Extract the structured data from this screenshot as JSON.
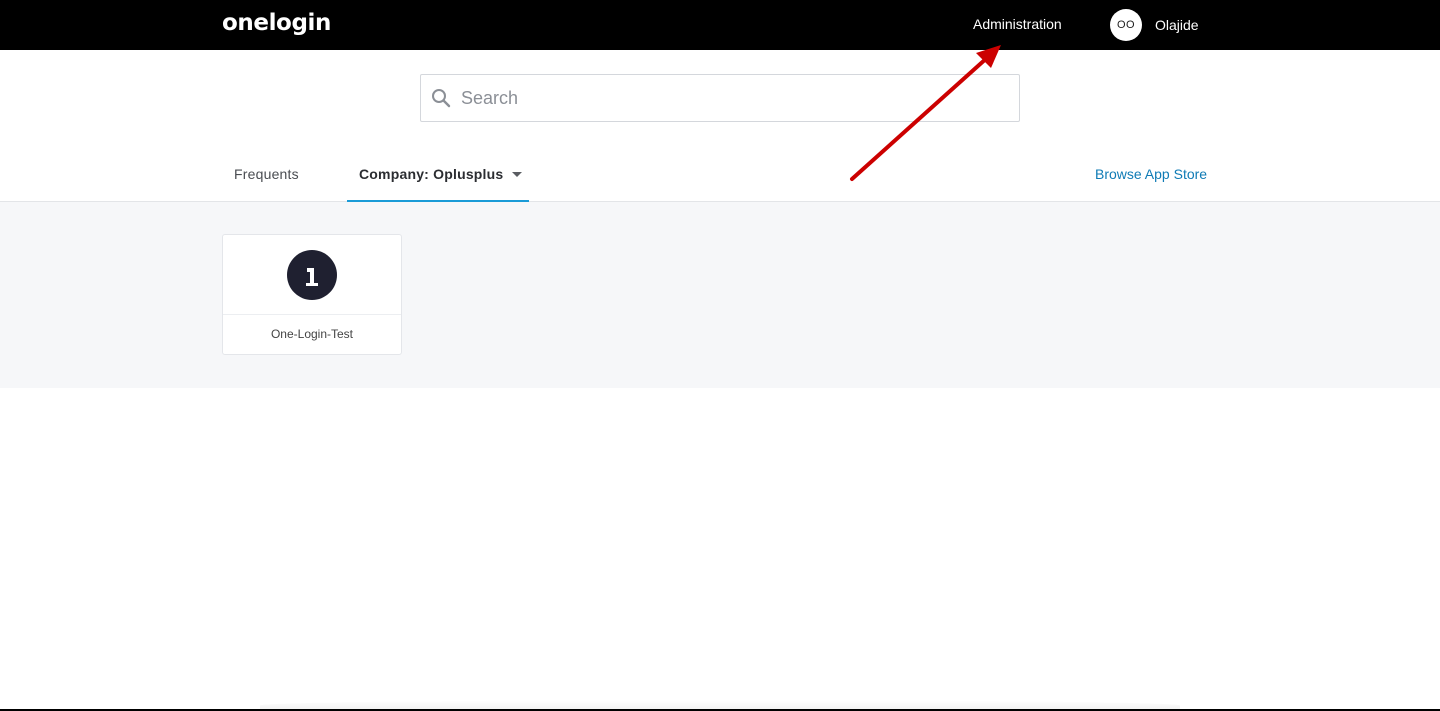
{
  "topbar": {
    "logo_text": "onelogin",
    "admin_label": "Administration",
    "avatar_initials": "OO",
    "username": "Olajide"
  },
  "search": {
    "placeholder": "Search",
    "value": ""
  },
  "tabs": [
    {
      "label": "Frequents",
      "active": false
    },
    {
      "label": "Company: Oplusplus",
      "active": true
    }
  ],
  "browse_link": "Browse App Store",
  "apps": [
    {
      "name": "One-Login-Test",
      "icon": "onelogin-1-icon"
    }
  ],
  "colors": {
    "topbar_bg": "#000000",
    "accent": "#1a9bd7",
    "link": "#0f7bb5",
    "annotation": "#cc0000",
    "app_logo_bg": "#1f2030"
  }
}
